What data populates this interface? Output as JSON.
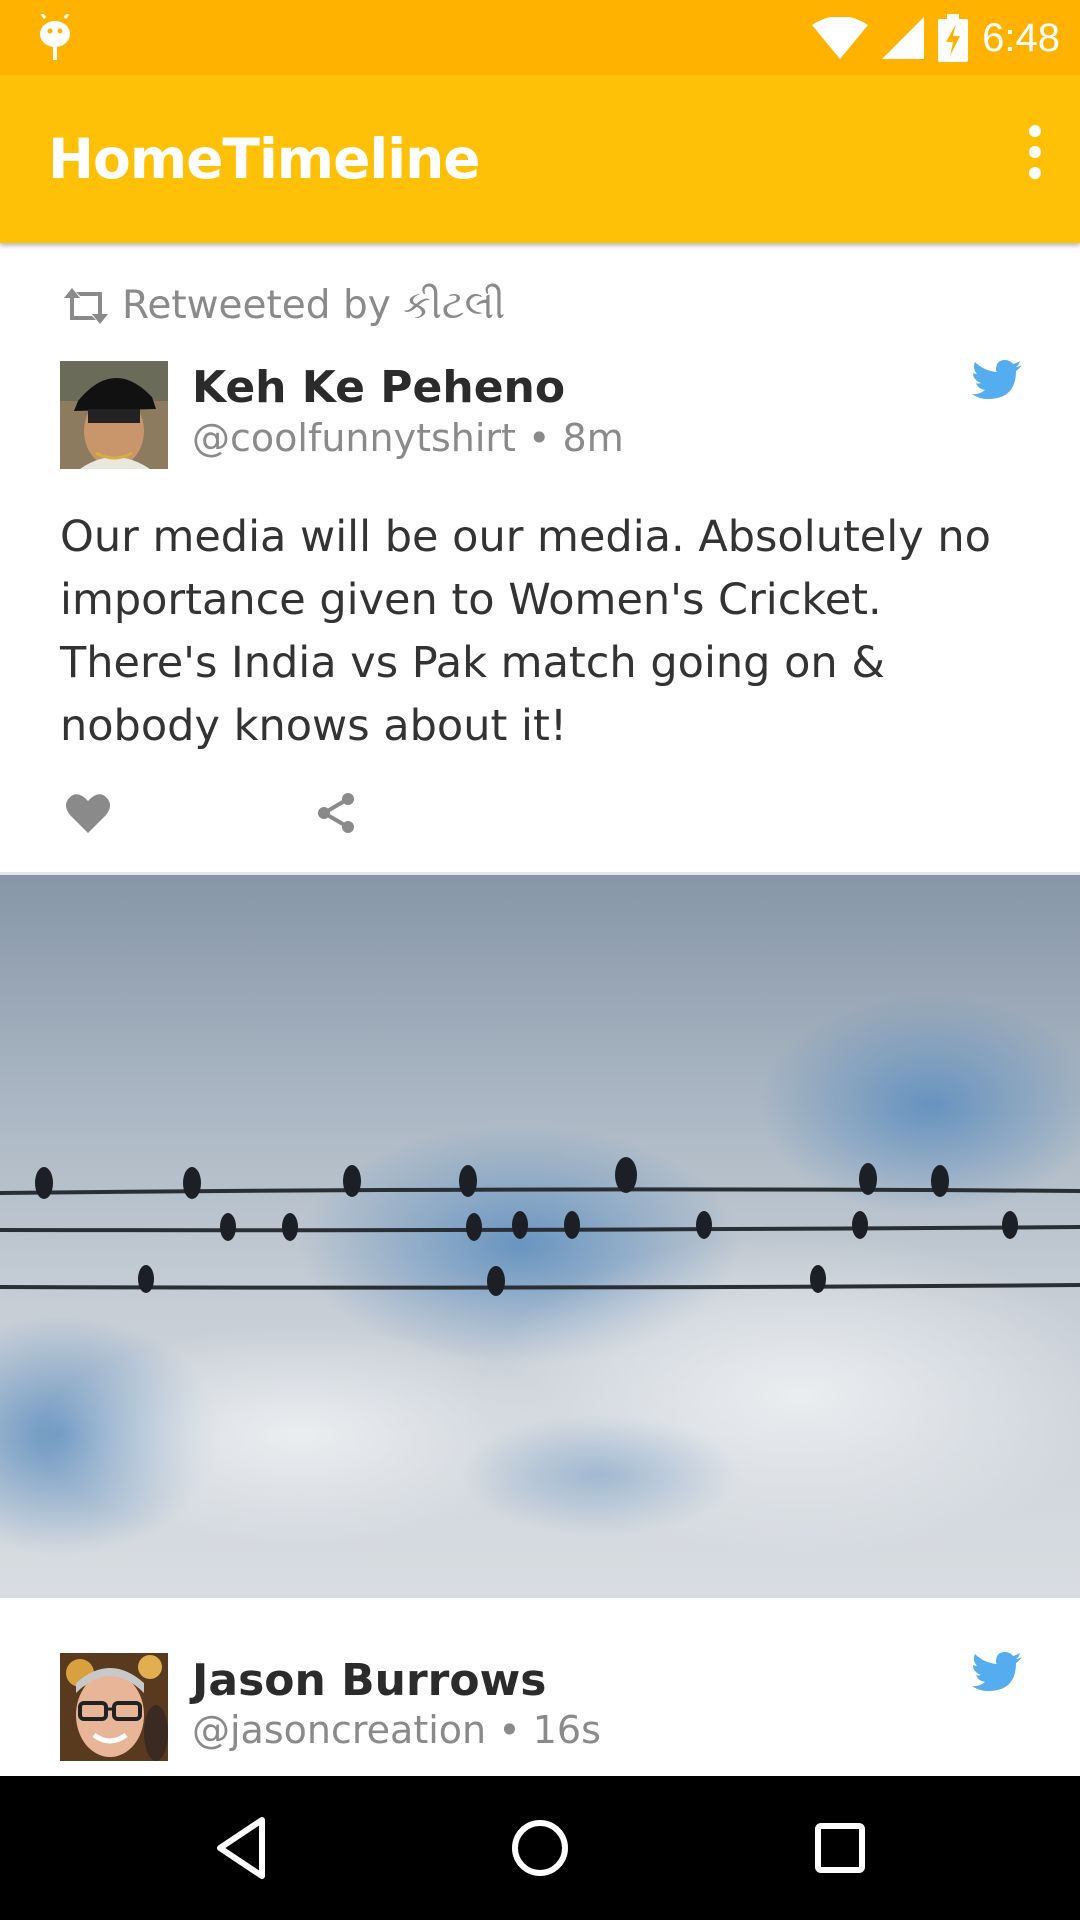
{
  "status_bar": {
    "time": "6:48"
  },
  "toolbar": {
    "title": "HomeTimeline"
  },
  "tweets": [
    {
      "retweeted_by": "Retweeted by કીટલી",
      "name": "Keh Ke Peheno",
      "handle": "@coolfunnytshirt",
      "time": "8m",
      "text": "Our media will be our media. Absolutely no importance given to Women's Cricket. There's India vs Pak match going on & nobody knows about it!"
    },
    {
      "name": "Jason Burrows",
      "handle": "@jasoncreation",
      "time": "16s"
    }
  ],
  "colors": {
    "status_bar": "#FFB300",
    "toolbar": "#FFC107",
    "twitter_blue": "#55ACEE",
    "nav_bar": "#000000"
  }
}
